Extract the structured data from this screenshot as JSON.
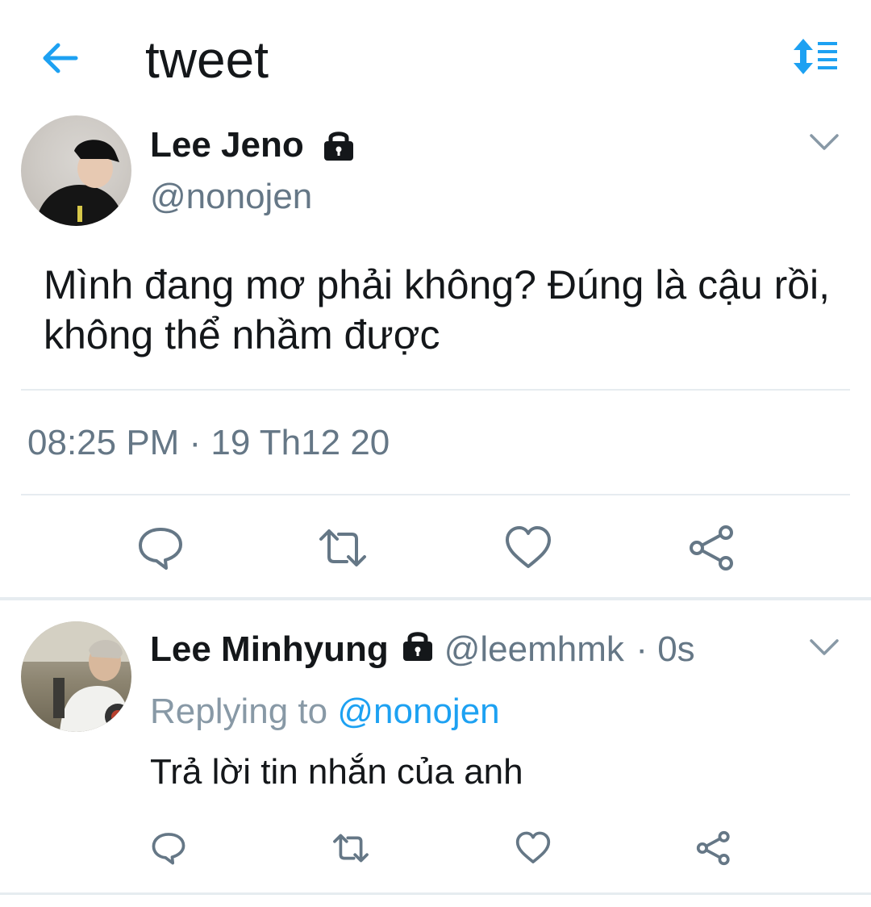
{
  "header": {
    "title": "tweet",
    "back_icon": "back-arrow-icon",
    "sort_icon": "sort-icon",
    "accent": "#1da1f2"
  },
  "tweet": {
    "author_name": "Lee Jeno",
    "author_handle": "@nonojen",
    "protected_icon": "lock-icon",
    "text": "Mình đang mơ phải không? Đúng là cậu rồi, không thể nhầm được",
    "timestamp": "08:25 PM · 19 Th12 20",
    "actions": [
      "reply-icon",
      "retweet-icon",
      "like-icon",
      "share-icon"
    ]
  },
  "reply": {
    "author_name": "Lee Minhyung",
    "author_handle": "@leemhmk",
    "age": "· 0s",
    "replying_prefix": "Replying to",
    "replying_mention": "@nonojen",
    "text": "Trả lời tin nhắn của anh",
    "actions": [
      "reply-icon",
      "retweet-icon",
      "like-icon",
      "share-icon"
    ]
  },
  "colors": {
    "text": "#14171a",
    "secondary": "#657786",
    "divider": "#e6ecf0",
    "accent": "#1da1f2"
  }
}
